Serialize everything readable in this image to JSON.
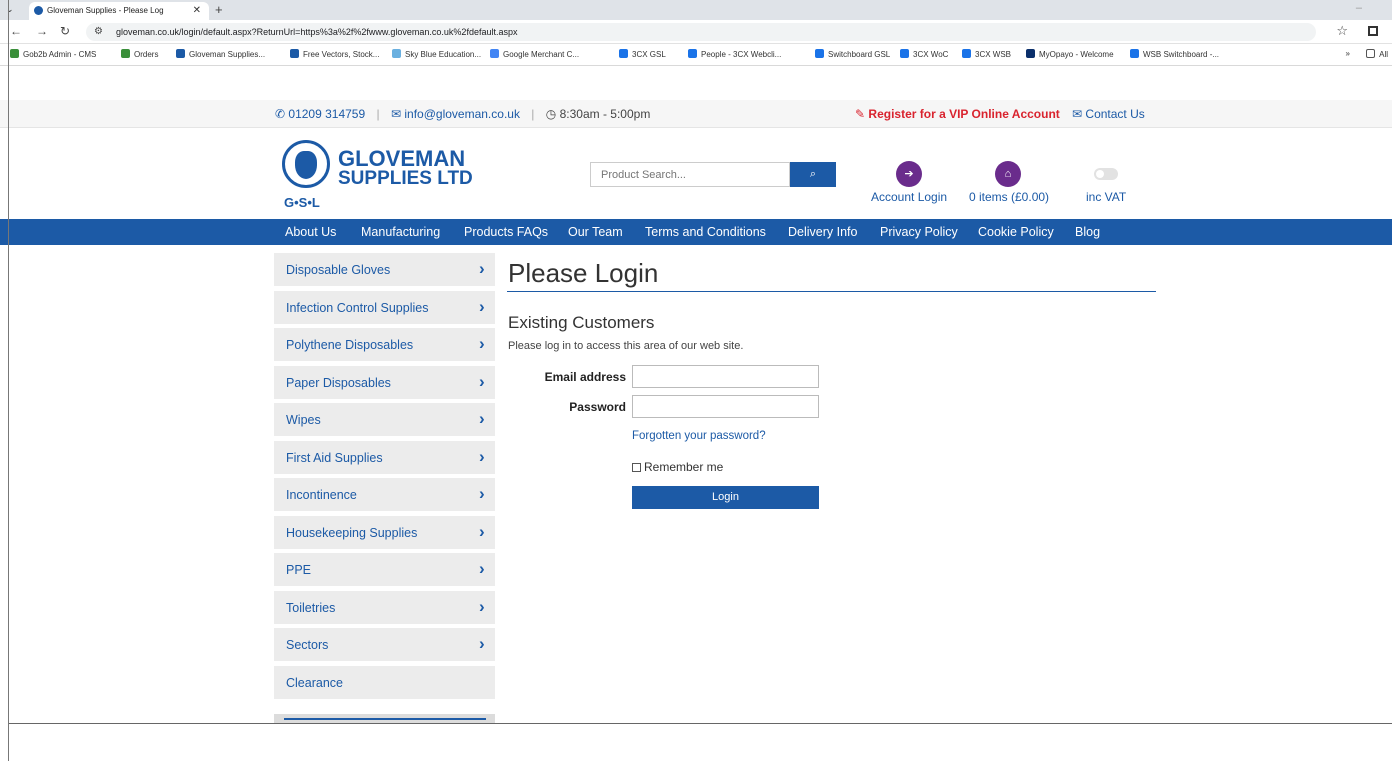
{
  "browser": {
    "tab_title": "Gloveman Supplies - Please Log",
    "tab_close": "✕",
    "new_tab": "+",
    "url": "gloveman.co.uk/login/default.aspx?ReturnUrl=https%3a%2f%2fwww.gloveman.co.uk%2fdefault.aspx",
    "bookmarks": [
      {
        "label": "Gob2b Admin - CMS",
        "color": "#3a8f3a"
      },
      {
        "label": "Orders",
        "color": "#3a8f3a"
      },
      {
        "label": "Gloveman Supplies...",
        "color": "#1c5aa6"
      },
      {
        "label": "Free Vectors, Stock...",
        "color": "#1c5aa6"
      },
      {
        "label": "Sky Blue Education...",
        "color": "#6ab0e0"
      },
      {
        "label": "Google Merchant C...",
        "color": "#4285f4"
      },
      {
        "label": "3CX GSL",
        "color": "#1a73e8"
      },
      {
        "label": "People - 3CX Webcli...",
        "color": "#1a73e8"
      },
      {
        "label": "Switchboard GSL",
        "color": "#1a73e8"
      },
      {
        "label": "3CX WoC",
        "color": "#1a73e8"
      },
      {
        "label": "3CX WSB",
        "color": "#1a73e8"
      },
      {
        "label": "MyOpayo - Welcome",
        "color": "#0b2f6b"
      },
      {
        "label": "WSB Switchboard -...",
        "color": "#1a73e8"
      }
    ],
    "bookmarks_overflow": "»",
    "all_bookmarks": "All"
  },
  "topbar": {
    "phone": "01209 314759",
    "email": "info@gloveman.co.uk",
    "hours": "8:30am - 5:00pm",
    "vip_link": "Register for a VIP Online Account",
    "contact_link": "Contact Us"
  },
  "header": {
    "logo_line1": "GLOVEMAN",
    "logo_line2": "SUPPLIES LTD",
    "logo_abbr": "G•S•L",
    "search_placeholder": "Product Search...",
    "account_login": "Account Login",
    "basket": "0 items (£0.00)",
    "vat_toggle": "inc VAT"
  },
  "nav": [
    "About Us",
    "Manufacturing",
    "Products FAQs",
    "Our Team",
    "Terms and Conditions",
    "Delivery Info",
    "Privacy Policy",
    "Cookie Policy",
    "Blog"
  ],
  "sidebar": {
    "categories": [
      "Disposable Gloves",
      "Infection Control Supplies",
      "Polythene Disposables",
      "Paper Disposables",
      "Wipes",
      "First Aid Supplies",
      "Incontinence",
      "Housekeeping Supplies",
      "PPE",
      "Toiletries",
      "Sectors",
      "Clearance"
    ]
  },
  "login": {
    "title": "Please Login",
    "subtitle": "Existing Customers",
    "intro": "Please log in to access this area of our web site.",
    "email_label": "Email address",
    "password_label": "Password",
    "forgot": "Forgotten your password?",
    "remember": "Remember me",
    "button": "Login"
  },
  "colors": {
    "brand_blue": "#1c5aa6",
    "vip_red": "#d9232e",
    "icon_purple": "#6a2c8c"
  }
}
